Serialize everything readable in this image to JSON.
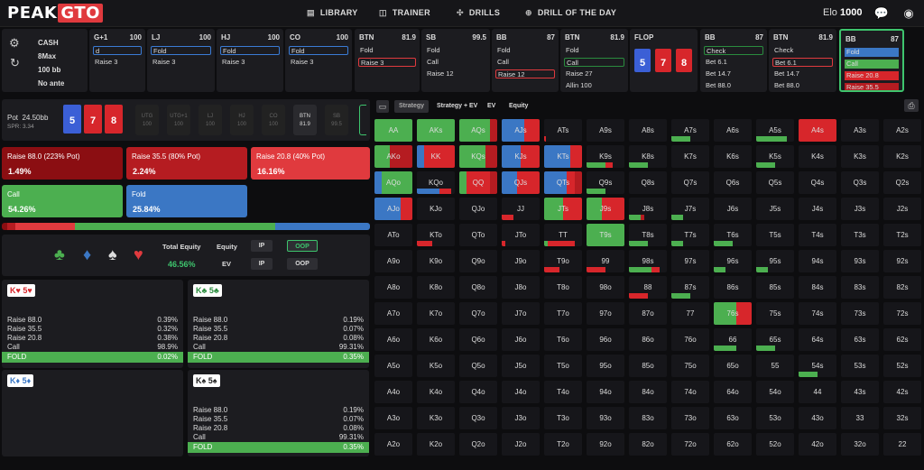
{
  "brand": {
    "peak": "PEAK",
    "gto": "GTO"
  },
  "nav": [
    {
      "icon": "library-icon",
      "label": "LIBRARY"
    },
    {
      "icon": "trainer-icon",
      "label": "TRAINER"
    },
    {
      "icon": "drills-icon",
      "label": "DRILLS"
    },
    {
      "icon": "drill-of-the-day-icon",
      "label": "DRILL OF THE DAY"
    }
  ],
  "elo": {
    "label": "Elo",
    "value": "1000"
  },
  "settings": {
    "mode": "CASH",
    "table": "8Max",
    "stack": "100 bb",
    "ante": "No ante"
  },
  "action_cards": [
    {
      "pos": "G+1",
      "stack": "100",
      "rows": [
        {
          "t": "d",
          "s": "boxed"
        },
        {
          "t": "Raise 3",
          "s": ""
        }
      ]
    },
    {
      "pos": "LJ",
      "stack": "100",
      "rows": [
        {
          "t": "Fold",
          "s": "boxed"
        },
        {
          "t": "Raise 3",
          "s": ""
        }
      ]
    },
    {
      "pos": "HJ",
      "stack": "100",
      "rows": [
        {
          "t": "Fold",
          "s": "boxed"
        },
        {
          "t": "Raise 3",
          "s": ""
        }
      ]
    },
    {
      "pos": "CO",
      "stack": "100",
      "rows": [
        {
          "t": "Fold",
          "s": "boxed"
        },
        {
          "t": "Raise 3",
          "s": ""
        }
      ]
    },
    {
      "pos": "BTN",
      "stack": "81.9",
      "rows": [
        {
          "t": "Fold",
          "s": ""
        },
        {
          "t": "Raise 3",
          "s": "red"
        }
      ]
    },
    {
      "pos": "SB",
      "stack": "99.5",
      "rows": [
        {
          "t": "Fold",
          "s": ""
        },
        {
          "t": "Call",
          "s": ""
        },
        {
          "t": "Raise 12",
          "s": ""
        }
      ]
    },
    {
      "pos": "BB",
      "stack": "87",
      "rows": [
        {
          "t": "Fold",
          "s": ""
        },
        {
          "t": "Call",
          "s": ""
        },
        {
          "t": "Raise 12",
          "s": "red"
        }
      ]
    },
    {
      "pos": "BTN",
      "stack": "81.9",
      "rows": [
        {
          "t": "Fold",
          "s": ""
        },
        {
          "t": "Call",
          "s": "green"
        },
        {
          "t": "Raise 27",
          "s": ""
        },
        {
          "t": "Allin 100",
          "s": ""
        }
      ]
    },
    {
      "pos": "FLOP",
      "stack": "",
      "rows": []
    },
    {
      "pos": "BB",
      "stack": "87",
      "rows": [
        {
          "t": "Check",
          "s": "green"
        },
        {
          "t": "Bet 6.1",
          "s": ""
        },
        {
          "t": "Bet 14.7",
          "s": ""
        },
        {
          "t": "Bet 88.0",
          "s": ""
        }
      ]
    },
    {
      "pos": "BTN",
      "stack": "81.9",
      "rows": [
        {
          "t": "Check",
          "s": ""
        },
        {
          "t": "Bet 6.1",
          "s": "red"
        },
        {
          "t": "Bet 14.7",
          "s": ""
        },
        {
          "t": "Bet 88.0",
          "s": ""
        }
      ]
    },
    {
      "pos": "BB",
      "stack": "87",
      "rows": [
        {
          "t": "Fold",
          "s": "f-blue"
        },
        {
          "t": "Call",
          "s": "f-green"
        },
        {
          "t": "Raise 20.8",
          "s": "f-red"
        },
        {
          "t": "Raise 35.5",
          "s": "f-red2"
        }
      ]
    }
  ],
  "flop": [
    "5",
    "7",
    "8"
  ],
  "pot": {
    "label": "Pot",
    "value": "24.50bb",
    "spr": "SPR: 3.34"
  },
  "board": [
    "5",
    "7",
    "8"
  ],
  "seats": [
    {
      "n": "UTG",
      "s": "100"
    },
    {
      "n": "UTG+1",
      "s": "100"
    },
    {
      "n": "LJ",
      "s": "100"
    },
    {
      "n": "HJ",
      "s": "100"
    },
    {
      "n": "CO",
      "s": "100"
    },
    {
      "n": "BTN",
      "s": "81.9"
    },
    {
      "n": "SB",
      "s": "99.5"
    }
  ],
  "actions": [
    {
      "label": "Raise 88.0 (223% Pot)",
      "pct": "1.49%",
      "color": "#8b0e12"
    },
    {
      "label": "Raise 35.5 (80% Pot)",
      "pct": "2.24%",
      "color": "#b51c21"
    },
    {
      "label": "Raise 20.8 (40% Pot)",
      "pct": "16.16%",
      "color": "#e03a3e"
    },
    {
      "label": "Call",
      "pct": "54.26%",
      "color": "#4caf50"
    },
    {
      "label": "Fold",
      "pct": "25.84%",
      "color": "#3b77c4"
    }
  ],
  "freq": [
    {
      "c": "#8b0e12",
      "v": 1.49
    },
    {
      "c": "#b51c21",
      "v": 2.24
    },
    {
      "c": "#e03a3e",
      "v": 16.16
    },
    {
      "c": "#4caf50",
      "v": 54.26
    },
    {
      "c": "#3b77c4",
      "v": 25.84
    }
  ],
  "equity": {
    "total_label": "Total Equity",
    "total": "46.56%",
    "equity_label": "Equity",
    "ev_label": "EV",
    "ip": "IP",
    "oop": "OOP"
  },
  "combos": [
    {
      "cards": "K♥ 5♥",
      "color": "#d7262b",
      "lines": [
        [
          "Raise 88.0",
          "0.39%"
        ],
        [
          "Raise 35.5",
          "0.32%"
        ],
        [
          "Raise 20.8",
          "0.38%"
        ],
        [
          "Call",
          "98.9%"
        ]
      ],
      "fold": "0.02%"
    },
    {
      "cards": "K♣ 5♣",
      "color": "#2a8c3e",
      "lines": [
        [
          "Raise 88.0",
          "0.19%"
        ],
        [
          "Raise 35.5",
          "0.07%"
        ],
        [
          "Raise 20.8",
          "0.08%"
        ],
        [
          "Call",
          "99.31%"
        ]
      ],
      "fold": "0.35%"
    },
    {
      "cards": "K♦ 5♦",
      "color": "#3b77c4",
      "lines": [],
      "fold": ""
    },
    {
      "cards": "K♠ 5♠",
      "color": "#222",
      "lines": [
        [
          "Raise 88.0",
          "0.19%"
        ],
        [
          "Raise 35.5",
          "0.07%"
        ],
        [
          "Raise 20.8",
          "0.08%"
        ],
        [
          "Call",
          "99.31%"
        ]
      ],
      "fold": "0.35%"
    }
  ],
  "fold_label": "FOLD",
  "grid_tabs": [
    "Strategy",
    "Strategy + EV",
    "EV",
    "Equity"
  ],
  "ranks": [
    "A",
    "K",
    "Q",
    "J",
    "T",
    "9",
    "8",
    "7",
    "6",
    "5",
    "4",
    "3",
    "2"
  ],
  "colors": {
    "fold": "#3b77c4",
    "call": "#4caf50",
    "raise": "#d7262b",
    "raise2": "#b51c21"
  }
}
